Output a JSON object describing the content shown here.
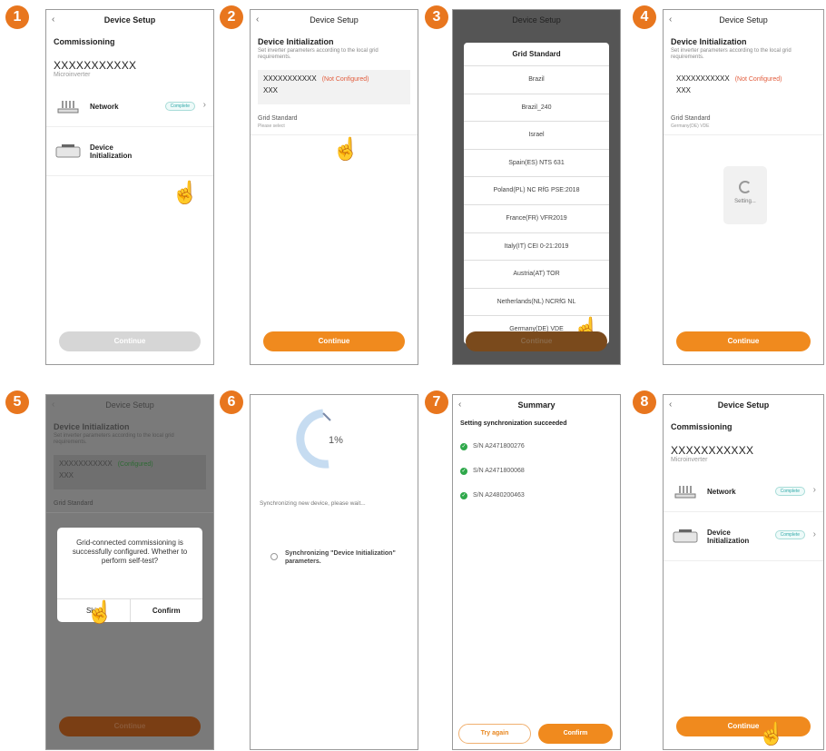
{
  "steps": [
    "1",
    "2",
    "3",
    "4",
    "5",
    "6",
    "7",
    "8"
  ],
  "s1": {
    "title": "Device Setup",
    "section": "Commissioning",
    "sn": "XXXXXXXXXXX",
    "model": "Microinverter",
    "network": "Network",
    "network_badge": "Complete",
    "device": "Device Initialization",
    "button": "Continue"
  },
  "s2": {
    "title": "Device Setup",
    "section": "Device Initialization",
    "desc": "Set inverter parameters according to the local grid requirements.",
    "sn": "XXXXXXXXXXX",
    "status": "(Not Configured)",
    "sub": "XXX",
    "gs_label": "Grid Standard",
    "gs_value": "Please select",
    "button": "Continue"
  },
  "s3": {
    "title": "Device Setup",
    "list_title": "Grid Standard",
    "options": [
      "Brazil",
      "Brazil_240",
      "Israel",
      "Spain(ES) NTS 631",
      "Poland(PL) NC RfG PSE:2018",
      "France(FR) VFR2019",
      "Italy(IT) CEI 0-21:2019",
      "Austria(AT) TOR",
      "Netherlands(NL) NCRfG NL",
      "Germany(DE) VDE"
    ],
    "button": "Continue"
  },
  "s4": {
    "title": "Device Setup",
    "section": "Device Initialization",
    "desc": "Set inverter parameters according to the local grid requirements.",
    "sn": "XXXXXXXXXXX",
    "status": "(Not Configured)",
    "sub": "XXX",
    "gs_label": "Grid Standard",
    "gs_value": "Germany(DE) VDE",
    "loading": "Setting...",
    "button": "Continue"
  },
  "s5": {
    "title": "Device Setup",
    "section": "Device Initialization",
    "desc": "Set inverter parameters according to the local grid requirements.",
    "sn": "XXXXXXXXXXX",
    "status": "(Configured)",
    "sub": "XXX",
    "gs_label": "Grid Standard",
    "dialog": "Grid-connected commissioning is successfully configured. Whether to perform self-test?",
    "skip": "Skip",
    "confirm": "Confirm",
    "button": "Continue"
  },
  "s6": {
    "percent": "1%",
    "wait": "Synchronizing new device, please wait...",
    "item": "Synchronizing \"Device Initialization\" parameters."
  },
  "s7": {
    "title": "Summary",
    "result": "Setting synchronization succeeded",
    "devices": [
      "S/N A2471800276",
      "S/N A2471800068",
      "S/N A2480200463"
    ],
    "try_again": "Try again",
    "confirm": "Confirm"
  },
  "s8": {
    "title": "Device Setup",
    "section": "Commissioning",
    "sn": "XXXXXXXXXXX",
    "model": "Microinverter",
    "network": "Network",
    "network_badge": "Complete",
    "device": "Device Initialization",
    "device_badge": "Complete",
    "button": "Continue"
  },
  "colors": {
    "accent": "#f08a1e",
    "error": "#e25c3c",
    "success": "#2ea84a"
  }
}
